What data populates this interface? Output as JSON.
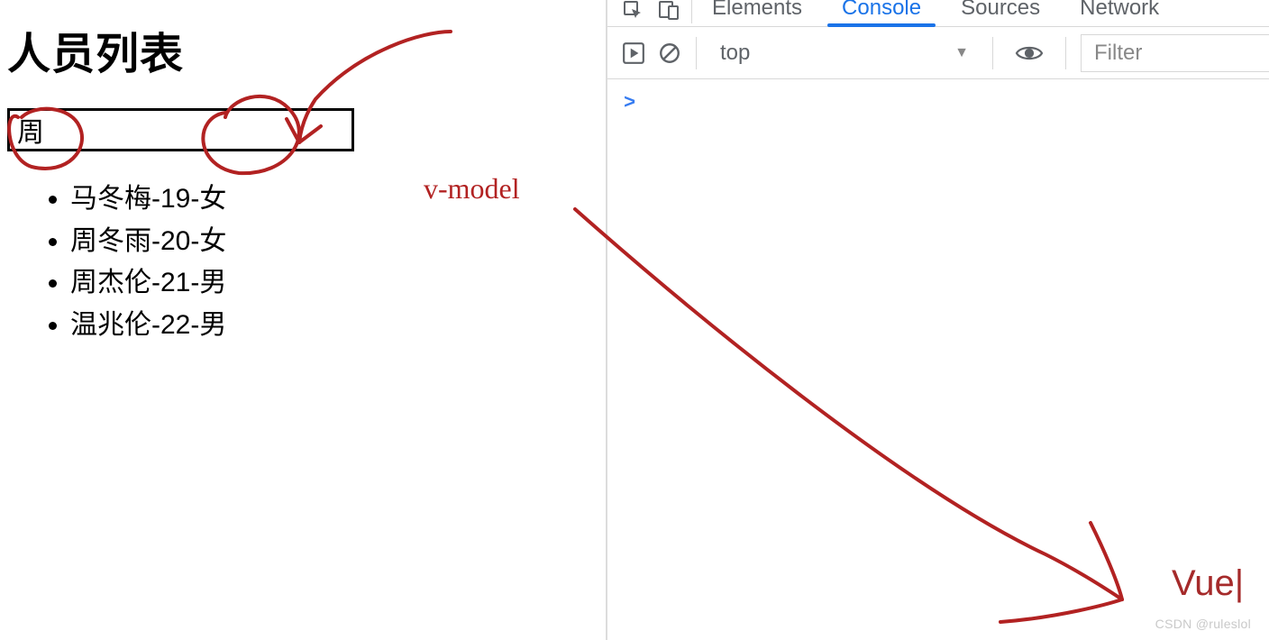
{
  "page": {
    "title": "人员列表",
    "search_value": "周"
  },
  "persons": [
    "马冬梅-19-女",
    "周冬雨-20-女",
    "周杰伦-21-男",
    "温兆伦-22-男"
  ],
  "devtools": {
    "tabs": {
      "elements": "Elements",
      "console": "Console",
      "sources": "Sources",
      "network": "Network"
    },
    "context": "top",
    "filter_placeholder": "Filter",
    "prompt": ">"
  },
  "annotations": {
    "vmodel": "v-model",
    "vue": "Vue|"
  },
  "watermark": "CSDN @ruleslol"
}
